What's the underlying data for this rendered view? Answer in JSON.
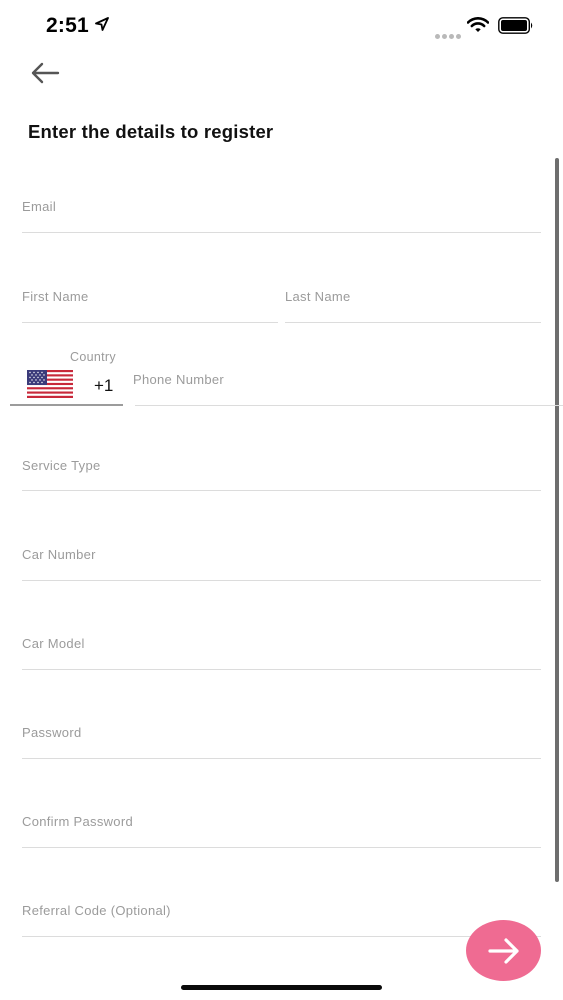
{
  "status_bar": {
    "time": "2:51",
    "icons": [
      "location-arrow-icon",
      "signal-dots-icon",
      "wifi-icon",
      "battery-icon"
    ]
  },
  "header": {
    "back_icon": "arrow-left-icon",
    "title": "Enter the details to register"
  },
  "form": {
    "email": {
      "placeholder": "Email",
      "value": ""
    },
    "first_name": {
      "placeholder": "First Name",
      "value": ""
    },
    "last_name": {
      "placeholder": "Last Name",
      "value": ""
    },
    "country": {
      "label": "Country",
      "flag_icon": "us-flag-icon",
      "dial_code": "+1"
    },
    "phone": {
      "placeholder": "Phone Number",
      "value": ""
    },
    "service_type": {
      "placeholder": "Service Type",
      "value": ""
    },
    "car_number": {
      "placeholder": "Car Number",
      "value": ""
    },
    "car_model": {
      "placeholder": "Car Model",
      "value": ""
    },
    "password": {
      "placeholder": "Password",
      "value": ""
    },
    "confirm_password": {
      "placeholder": "Confirm Password",
      "value": ""
    },
    "referral_code": {
      "placeholder": "Referral Code (Optional)",
      "value": ""
    }
  },
  "next_button": {
    "icon": "arrow-right-icon"
  },
  "colors": {
    "accent": "#ef6b92",
    "placeholder": "#9b9b9b",
    "divider": "#dcdcdc"
  }
}
